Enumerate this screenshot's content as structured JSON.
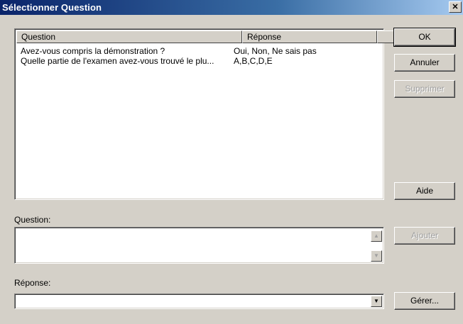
{
  "window": {
    "title": "Sélectionner Question",
    "close_glyph": "✕"
  },
  "list": {
    "columns": [
      "Question",
      "Réponse",
      ""
    ],
    "rows": [
      {
        "question": "Avez-vous compris la démonstration ?",
        "answer": "Oui, Non, Ne sais pas"
      },
      {
        "question": "Quelle partie de l'examen avez-vous trouvé le plu...",
        "answer": "A,B,C,D,E"
      }
    ]
  },
  "buttons": {
    "ok": "OK",
    "cancel": "Annuler",
    "delete": "Supprimer",
    "help": "Aide",
    "add": "Ajouter",
    "manage": "Gérer..."
  },
  "question_field": {
    "label": "Question:",
    "value": ""
  },
  "answer_field": {
    "label": "Réponse:",
    "value": ""
  },
  "icons": {
    "scroll_up": "▲",
    "scroll_down": "▼",
    "dropdown": "▼"
  }
}
